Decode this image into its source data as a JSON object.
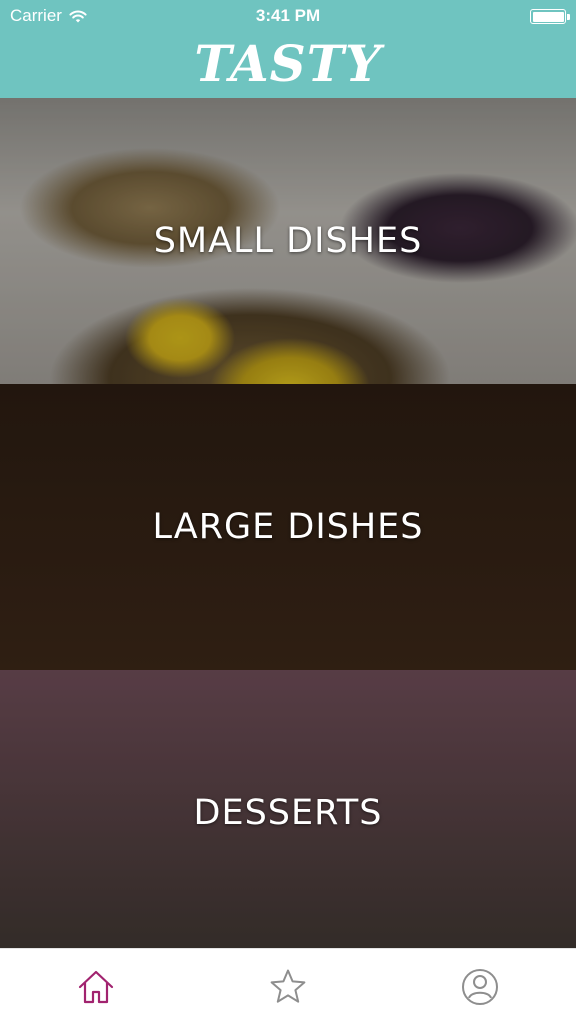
{
  "status_bar": {
    "carrier": "Carrier",
    "time": "3:41 PM"
  },
  "header": {
    "logo_text": "TASTY",
    "background_color": "#6fc4c0"
  },
  "categories": [
    {
      "label": "SMALL DISHES"
    },
    {
      "label": "LARGE DISHES"
    },
    {
      "label": "DESSERTS"
    }
  ],
  "tabbar": {
    "tabs": [
      {
        "icon": "home-icon",
        "active": true,
        "color": "#a1236f"
      },
      {
        "icon": "star-icon",
        "active": false,
        "color": "#8e8e8e"
      },
      {
        "icon": "profile-icon",
        "active": false,
        "color": "#8e8e8e"
      }
    ]
  }
}
